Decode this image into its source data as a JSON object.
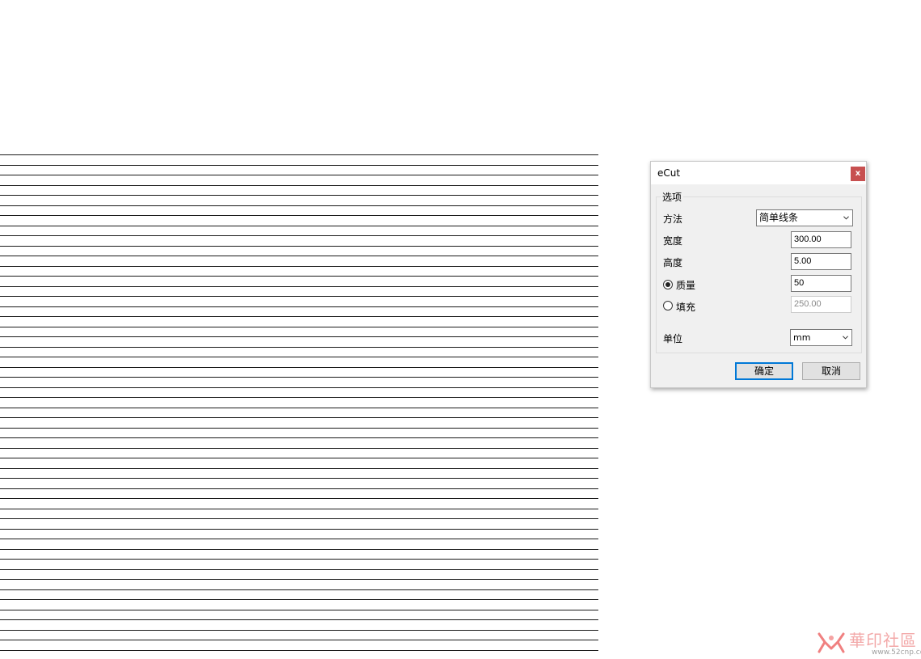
{
  "dialog": {
    "title": "eCut",
    "close_label": "x",
    "group_label": "选项",
    "method_label": "方法",
    "method_value": "简单线条",
    "width_label": "宽度",
    "width_value": "300.00",
    "height_label": "高度",
    "height_value": "5.00",
    "quality_label": "质量",
    "quality_value": "50",
    "quality_selected": true,
    "fill_label": "填充",
    "fill_value": "250.00",
    "fill_selected": false,
    "unit_label": "单位",
    "unit_value": "mm",
    "ok_label": "确定",
    "cancel_label": "取消"
  },
  "canvas": {
    "line_color": "#1a1a1a"
  },
  "watermark": {
    "text": "華印社區",
    "url": "www.52cnp.com"
  }
}
